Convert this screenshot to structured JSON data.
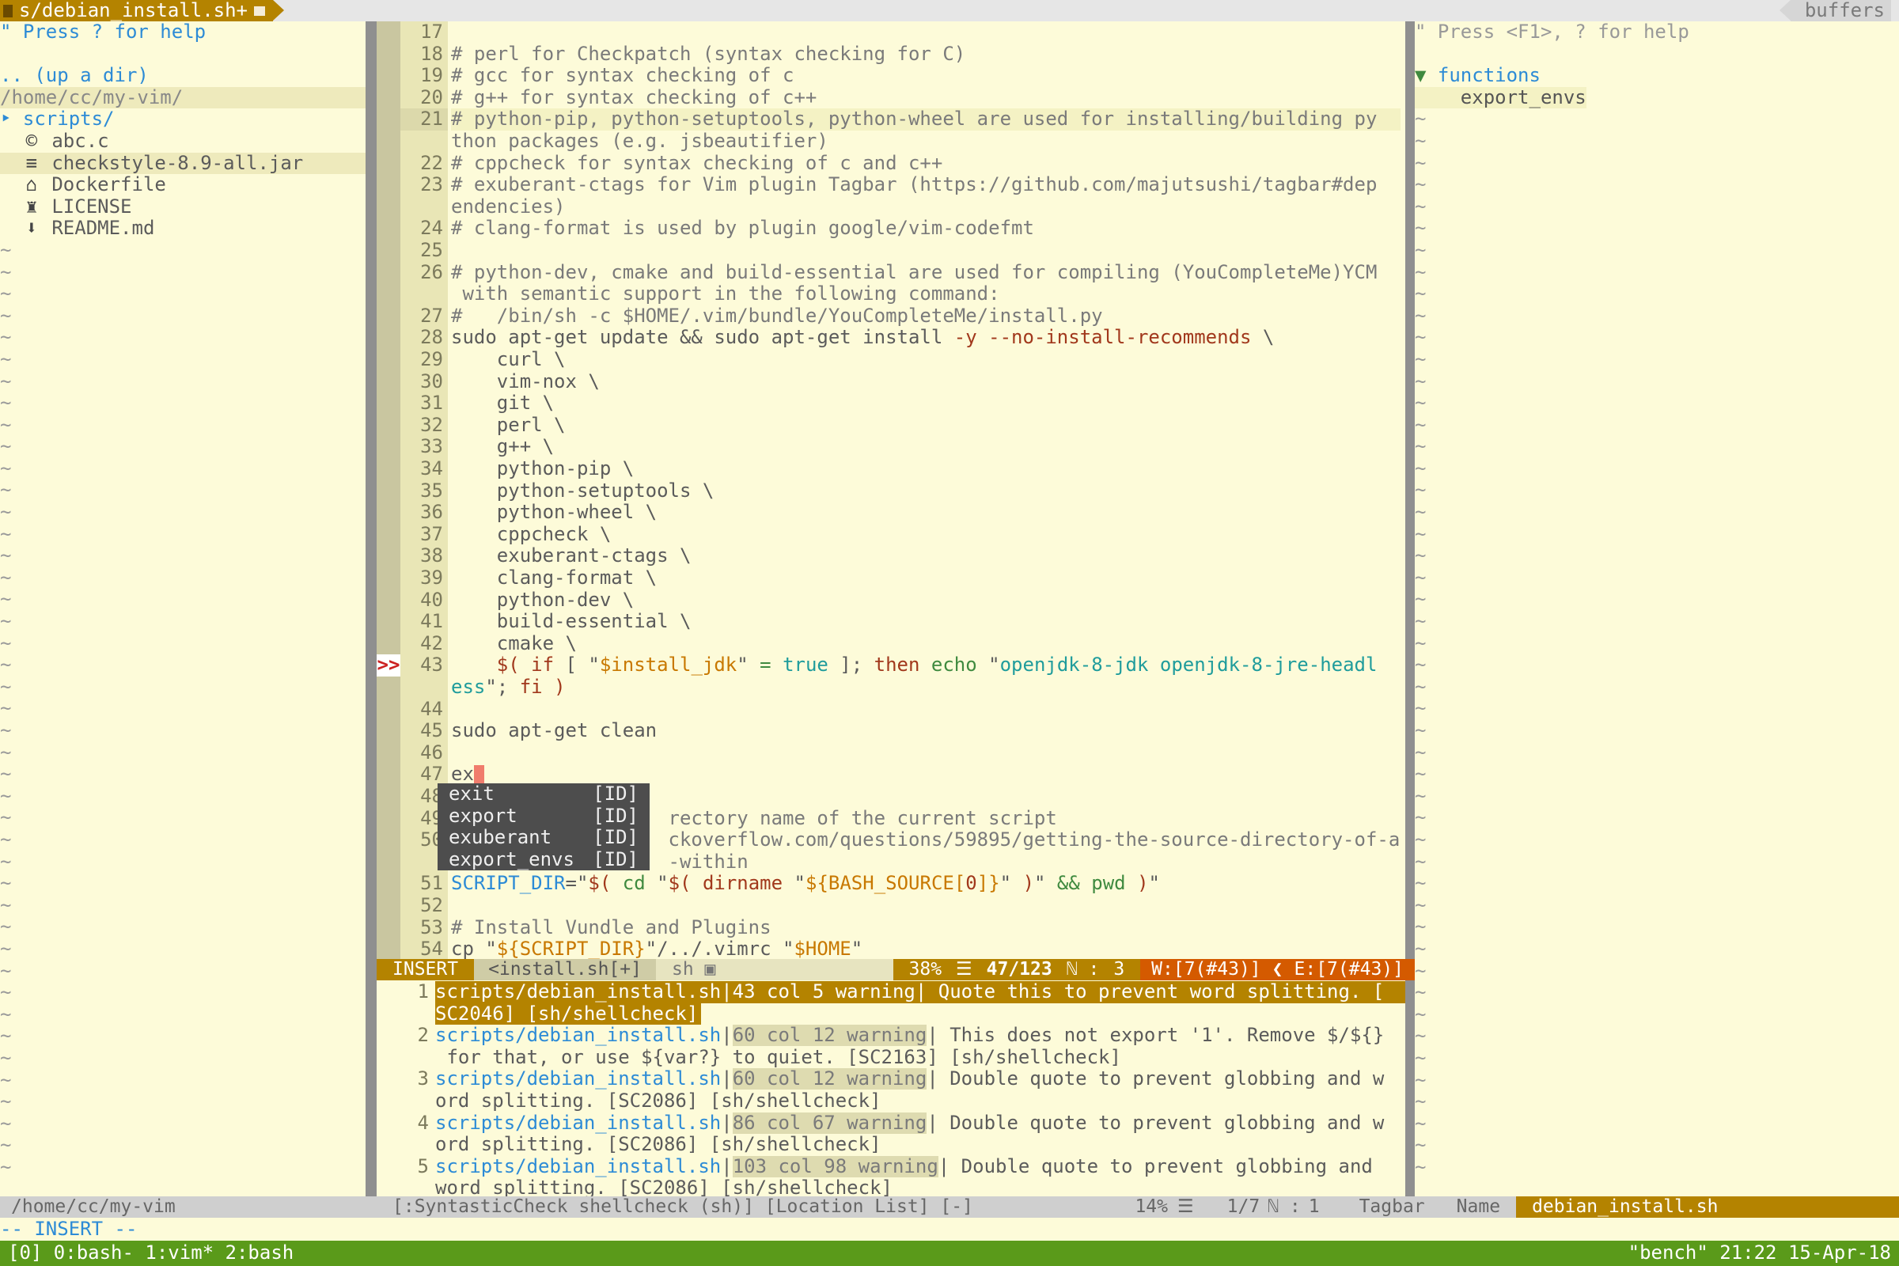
{
  "tabline": {
    "active_tab": "s/debian_install.sh+",
    "right_label": "buffers"
  },
  "nerdtree": {
    "help": "\" Press ? for help",
    "up_dir": ".. (up a dir)",
    "cwd": "/home/cc/my-vim/",
    "folder": "scripts/",
    "files": [
      "abc.c",
      "checkstyle-8.9-all.jar",
      "Dockerfile",
      "LICENSE",
      "README.md"
    ]
  },
  "editor": {
    "lines": [
      {
        "n": "17",
        "t": ""
      },
      {
        "n": "18",
        "t": "# perl for Checkpatch (syntax checking for C)",
        "c": "comment"
      },
      {
        "n": "19",
        "t": "# gcc for syntax checking of c",
        "c": "comment"
      },
      {
        "n": "20",
        "t": "# g++ for syntax checking of c++",
        "c": "comment"
      },
      {
        "n": "21",
        "t": "# python-pip, python-setuptools, python-wheel are used for installing/building py",
        "c": "comment",
        "cur": true
      },
      {
        "n": "",
        "t": "thon packages (e.g. jsbeautifier)",
        "c": "comment"
      },
      {
        "n": "22",
        "t": "# cppcheck for syntax checking of c and c++",
        "c": "comment"
      },
      {
        "n": "23",
        "t": "# exuberant-ctags for Vim plugin Tagbar (https://github.com/majutsushi/tagbar#dep",
        "c": "comment"
      },
      {
        "n": "",
        "t": "endencies)",
        "c": "comment"
      },
      {
        "n": "24",
        "t": "# clang-format is used by plugin google/vim-codefmt",
        "c": "comment"
      },
      {
        "n": "25",
        "t": ""
      },
      {
        "n": "26",
        "t": "# python-dev, cmake and build-essential are used for compiling (YouCompleteMe)YCM",
        "c": "comment"
      },
      {
        "n": "",
        "t": " with semantic support in the following command:",
        "c": "comment"
      },
      {
        "n": "27",
        "t": "#   /bin/sh -c $HOME/.vim/bundle/YouCompleteMe/install.py",
        "c": "comment"
      },
      {
        "n": "28",
        "t": "sudo apt-get update && sudo apt-get install ",
        "tail": "-y --no-install-recommends",
        "tail2": " \\"
      },
      {
        "n": "29",
        "t": "    curl \\",
        "c": "cont"
      },
      {
        "n": "30",
        "t": "    vim-nox \\",
        "c": "cont"
      },
      {
        "n": "31",
        "t": "    git \\",
        "c": "cont"
      },
      {
        "n": "32",
        "t": "    perl \\",
        "c": "cont"
      },
      {
        "n": "33",
        "t": "    g++ \\",
        "c": "cont"
      },
      {
        "n": "34",
        "t": "    python-pip \\",
        "c": "cont"
      },
      {
        "n": "35",
        "t": "    python-setuptools \\",
        "c": "cont"
      },
      {
        "n": "36",
        "t": "    python-wheel \\",
        "c": "cont"
      },
      {
        "n": "37",
        "t": "    cppcheck \\",
        "c": "cont"
      },
      {
        "n": "38",
        "t": "    exuberant-ctags \\",
        "c": "cont"
      },
      {
        "n": "39",
        "t": "    clang-format \\",
        "c": "cont"
      },
      {
        "n": "40",
        "t": "    python-dev \\",
        "c": "cont"
      },
      {
        "n": "41",
        "t": "    build-essential \\",
        "c": "cont"
      },
      {
        "n": "42",
        "t": "    cmake \\",
        "c": "cont"
      },
      {
        "n": "43",
        "t": "    $( if [ \"$install_jdk\" = true ]; then echo \"openjdk-8-jdk openjdk-8-jre-headl",
        "c": "l43",
        "sign": ">>"
      },
      {
        "n": "",
        "t": "ess\"; fi )",
        "c": "l43b"
      },
      {
        "n": "44",
        "t": ""
      },
      {
        "n": "45",
        "t": "sudo apt-get clean"
      },
      {
        "n": "46",
        "t": ""
      },
      {
        "n": "47",
        "t": "ex",
        "cursor": true
      },
      {
        "n": "48",
        "t": ""
      },
      {
        "n": "49",
        "t": "                   rectory name of the current script",
        "c": "comment"
      },
      {
        "n": "50",
        "t": "                   ckoverflow.com/questions/59895/getting-the-source-directory-of-a",
        "c": "comment"
      },
      {
        "n": "",
        "t": "                   -within",
        "c": "comment"
      },
      {
        "n": "51",
        "t": "SCRIPT_DIR=\"$( cd \"$( dirname \"${BASH_SOURCE[0]}\" )\" && pwd )\"",
        "c": "l51"
      },
      {
        "n": "52",
        "t": ""
      },
      {
        "n": "53",
        "t": "# Install Vundle and Plugins",
        "c": "comment"
      },
      {
        "n": "54",
        "t": "cp \"${SCRIPT_DIR}\"/../.vimrc \"$HOME\"",
        "c": "l54"
      }
    ]
  },
  "popup": {
    "items": [
      {
        "word": "exit",
        "kind": "[ID]"
      },
      {
        "word": "export",
        "kind": "[ID]"
      },
      {
        "word": "exuberant",
        "kind": "[ID]"
      },
      {
        "word": "export_envs",
        "kind": "[ID]"
      }
    ]
  },
  "statusline": {
    "mode": "INSERT",
    "file": "<install.sh[+]",
    "filetype": "sh",
    "percent": "38%",
    "position": "47/123",
    "col": "3",
    "warnings": "W:[7(#43)]",
    "errors": "E:[7(#43)]"
  },
  "loclist": {
    "entries": [
      {
        "n": "1",
        "file": "scripts/debian_install.sh",
        "meta": "43 col 5 warning",
        "msg": " Quote this to prevent word splitting. [",
        "cont": "SC2046] [sh/shellcheck]",
        "selected": true
      },
      {
        "n": "2",
        "file": "scripts/debian_install.sh",
        "meta": "60 col 12 warning",
        "msg": " This does not export '1'. Remove $/${}",
        "cont": " for that, or use ${var?} to quiet. [SC2163] [sh/shellcheck]"
      },
      {
        "n": "3",
        "file": "scripts/debian_install.sh",
        "meta": "60 col 12 warning",
        "msg": " Double quote to prevent globbing and w",
        "cont": "ord splitting. [SC2086] [sh/shellcheck]"
      },
      {
        "n": "4",
        "file": "scripts/debian_install.sh",
        "meta": "86 col 67 warning",
        "msg": " Double quote to prevent globbing and w",
        "cont": "ord splitting. [SC2086] [sh/shellcheck]"
      },
      {
        "n": "5",
        "file": "scripts/debian_install.sh",
        "meta": "103 col 98 warning",
        "msg": " Double quote to prevent globbing and",
        "cont": "word splitting. [SC2086] [sh/shellcheck]"
      }
    ]
  },
  "tagbar": {
    "help": "\" Press <F1>, ? for help",
    "group": "functions",
    "item": "export_envs"
  },
  "global_status": {
    "left": "/home/cc/my-vim",
    "loclist_title": "[:SyntasticCheck shellcheck (sh)] [Location List] [-]",
    "percent": "14%",
    "position": "1/7",
    "col": "1",
    "tagbar": "Tagbar",
    "sort": "Name",
    "file": "debian_install.sh"
  },
  "cmdline": "-- INSERT --",
  "tmux": {
    "left": "[0] 0:bash- 1:vim* 2:bash",
    "right": "\"bench\" 21:22 15-Apr-18"
  },
  "colors": {
    "background": "#fdfbd9",
    "accent": "#b48300",
    "warning": "#d45a00",
    "tmux": "#5a9a1a"
  }
}
